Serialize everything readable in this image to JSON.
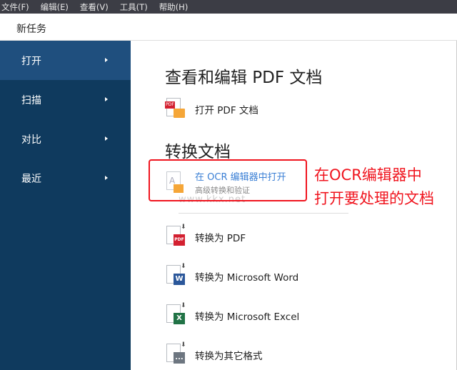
{
  "menu": [
    "文件(F)",
    "编辑(E)",
    "查看(V)",
    "工具(T)",
    "帮助(H)"
  ],
  "new_task": "新任务",
  "sidebar": {
    "items": [
      {
        "label": "打开",
        "selected": true
      },
      {
        "label": "扫描"
      },
      {
        "label": "对比"
      },
      {
        "label": "最近"
      }
    ]
  },
  "main": {
    "view_edit_heading": "查看和编辑 PDF 文档",
    "open_pdf": {
      "label": "打开 PDF 文档",
      "badge": "PDF"
    },
    "convert_heading": "转换文档",
    "ocr": {
      "title": "在 OCR 编辑器中打开",
      "subtitle": "高级转换和验证",
      "badge": "A"
    },
    "convert_items": [
      {
        "label": "转换为 PDF",
        "badge": "PDF",
        "color": "#d32030"
      },
      {
        "label": "转换为 Microsoft Word",
        "badge": "W",
        "color": "#2b579a"
      },
      {
        "label": "转换为 Microsoft Excel",
        "badge": "X",
        "color": "#217346"
      },
      {
        "label": "转换为其它格式",
        "badge": "...",
        "color": "#6d7680"
      }
    ]
  },
  "annotation": {
    "line1": "在OCR编辑器中",
    "line2": "打开要处理的文档"
  },
  "watermark": "www.kkx.net"
}
